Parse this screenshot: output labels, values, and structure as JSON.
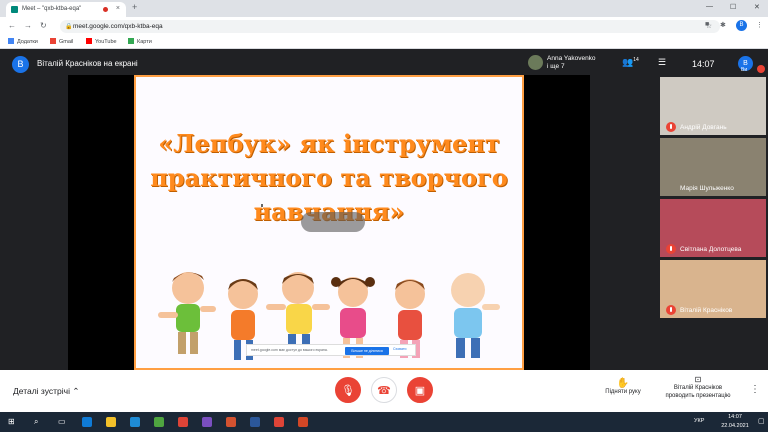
{
  "browser": {
    "tab_title": "Meet – \"qxb-ktba-eqa\"",
    "new_tab": "+",
    "tab_close": "×",
    "url": "meet.google.com/qxb-ktba-eqa",
    "profile_initial": "B",
    "win_min": "—",
    "win_max": "☐",
    "win_close": "✕",
    "bookmarks": [
      {
        "label": "Додатки",
        "color": "#4285f4"
      },
      {
        "label": "Gmail",
        "color": "#ea4335"
      },
      {
        "label": "YouTube",
        "color": "#ff0000"
      },
      {
        "label": "Карти",
        "color": "#34a853"
      }
    ]
  },
  "meet": {
    "presenter_initial": "B",
    "presenter_title": "Віталій Красніков на екрані",
    "joiner_line1": "Anna Yakovenko",
    "joiner_line2": "і ще 7",
    "people_icon": "people-icon",
    "people_count": "14",
    "chat_icon": "chat-icon",
    "time": "14:07",
    "self_initial": "B",
    "self_label": "Ви",
    "slide": {
      "title_line1": "«Лепбук» як інструмент",
      "title_line2": "практичного та творчого",
      "title_line3": "навчання»",
      "share_notice": "meet.google.com має доступ до вашого екрана.",
      "share_stop": "Більше не ділитися",
      "share_hide": "Сховати"
    },
    "participants": [
      {
        "name": "Андрій Довгань",
        "muted": true,
        "bg": "#cfcac2"
      },
      {
        "name": "Марія Шульженко",
        "muted": false,
        "bg": "#8a8270"
      },
      {
        "name": "Світлана Долотцева",
        "muted": true,
        "bg": "#b64b5a"
      },
      {
        "name": "Віталій Красніков",
        "muted": true,
        "bg": "#d9b48e"
      }
    ],
    "bottom": {
      "details_label": "Деталі зустрічі",
      "raise_hand": "Підняти руку",
      "presenting_line1": "Віталій Красніков",
      "presenting_line2": "проводить презентацію"
    }
  },
  "taskbar": {
    "lang": "УКР",
    "time": "14:07",
    "date": "22.04.2021"
  }
}
